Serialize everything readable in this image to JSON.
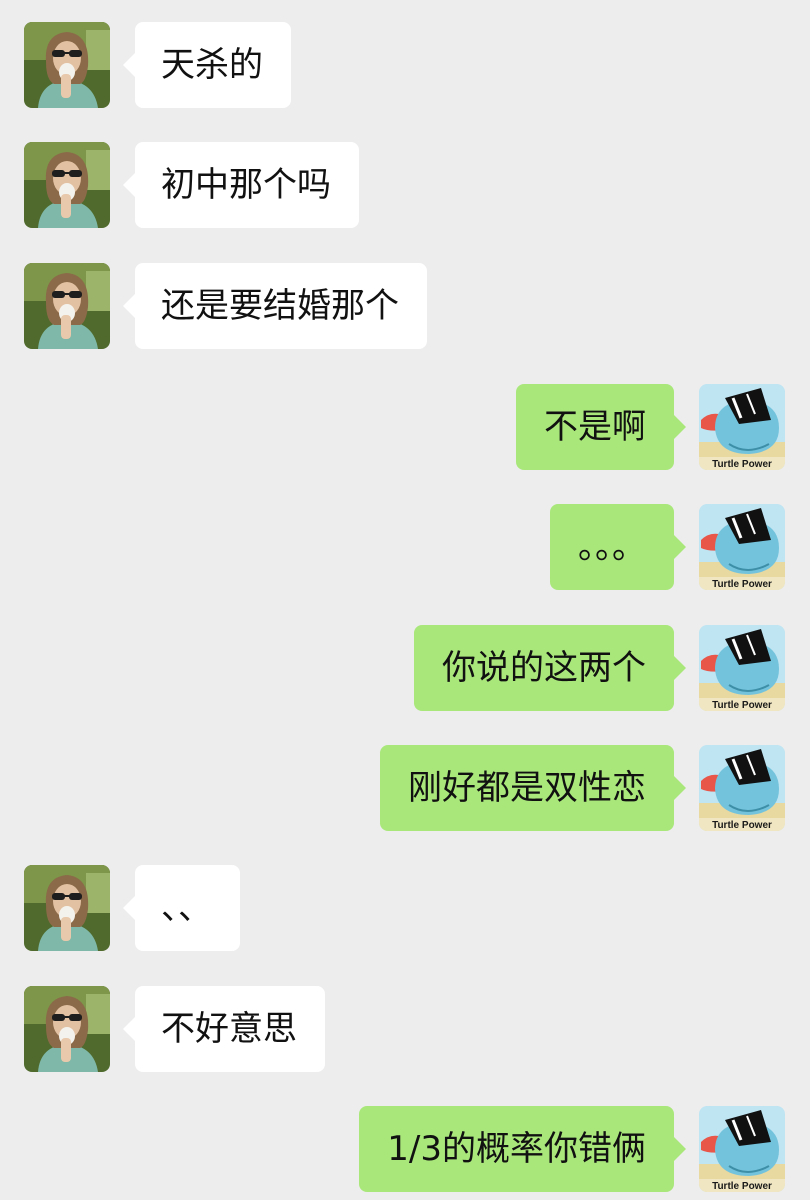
{
  "messages": [
    {
      "side": "left",
      "text": "天杀的"
    },
    {
      "side": "left",
      "text": "初中那个吗"
    },
    {
      "side": "left",
      "text": "还是要结婚那个"
    },
    {
      "side": "right",
      "text": "不是啊"
    },
    {
      "side": "right",
      "text": "。。。"
    },
    {
      "side": "right",
      "text": "你说的这两个"
    },
    {
      "side": "right",
      "text": "刚好都是双性恋"
    },
    {
      "side": "left",
      "text": "、、"
    },
    {
      "side": "left",
      "text": "不好意思"
    },
    {
      "side": "right",
      "text": "1/3的概率你错俩"
    }
  ],
  "avatars": {
    "self_caption": "Turtle Power",
    "other_icon": "person-with-sunglasses-photo-icon",
    "self_icon": "turtle-with-sunglasses-icon"
  },
  "colors": {
    "background": "#ededed",
    "incoming_bubble": "#ffffff",
    "outgoing_bubble": "#a9e77b"
  }
}
